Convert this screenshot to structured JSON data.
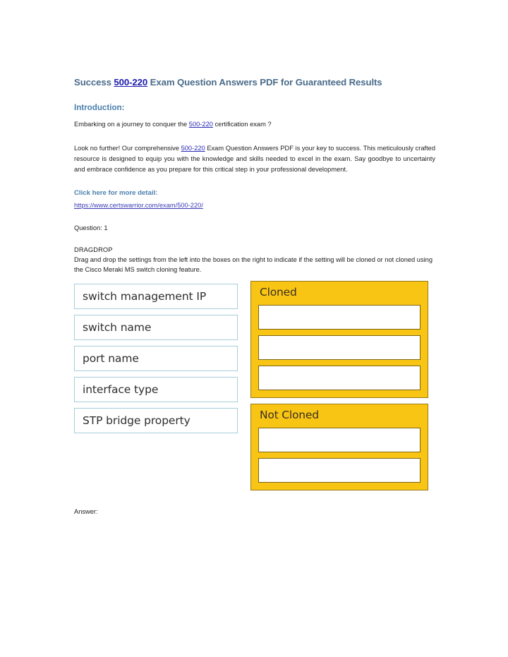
{
  "document": {
    "title_parts": {
      "before": "Success ",
      "link": "500-220",
      "after": " Exam Question Answers PDF for Guaranteed Results"
    },
    "introduction_heading": "Introduction:",
    "intro_line": {
      "before": "Embarking on a journey to conquer the ",
      "link": "500-220",
      "after": " certification exam ?"
    },
    "lead_paragraph": {
      "before": "Look no further! Our comprehensive ",
      "link": "500-220",
      "after": "  Exam Question Answers PDF is your key to success. This meticulously crafted resource is designed to equip you with the knowledge and skills needed to excel in the exam. Say goodbye to uncertainty and embrace confidence as you prepare for this critical step in your professional development."
    },
    "click_here_heading": "Click here for more detail:",
    "url": "https://www.certswarrior.com/exam/500-220/",
    "question_label": "Question: 1",
    "question_type": "DRAGDROP",
    "prompt": "Drag and drop the settings from the left into the boxes on the right to indicate if the setting will be cloned or not cloned using the Cisco Meraki MS switch cloning feature.",
    "answer_label": "Answer:"
  },
  "drag_drop": {
    "draggable_items": [
      "switch management IP",
      "switch name",
      "port name",
      "interface type",
      "STP bridge property"
    ],
    "drop_zones": [
      {
        "title": "Cloned",
        "slot_count": 3,
        "slots": [
          "",
          "",
          ""
        ]
      },
      {
        "title": "Not Cloned",
        "slot_count": 2,
        "slots": [
          "",
          ""
        ]
      }
    ]
  },
  "colors": {
    "title": "#4a6b8a",
    "heading": "#4a7fae",
    "link": "#2b2bb5",
    "zone_fill": "#f9c515",
    "zone_border": "#9a7a15",
    "slot_border": "#7d6512",
    "item_border": "#a6cdd9",
    "background": "#ffffff"
  }
}
